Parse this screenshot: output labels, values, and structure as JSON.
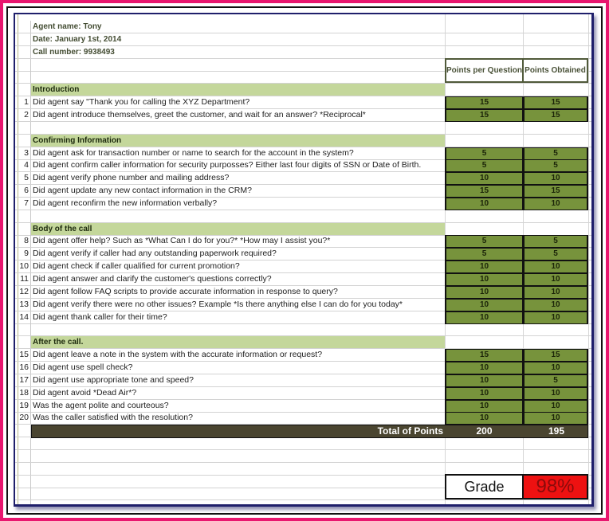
{
  "agent_info": {
    "agent_name": "Agent name: Tony",
    "date": "Date: January 1st, 2014",
    "call_number": "Call number: 9938493"
  },
  "columns": {
    "points_per_question": "Points per Question",
    "points_obtained": "Points Obtained"
  },
  "sections": [
    {
      "title": "Introduction",
      "questions": [
        {
          "num": "1",
          "text": "Did agent say \"Thank you for calling the XYZ Department?",
          "ppq": "15",
          "po": "15"
        },
        {
          "num": "2",
          "text": "Did agent introduce themselves, greet the customer, and wait for an answer? *Reciprocal*",
          "ppq": "15",
          "po": "15"
        }
      ]
    },
    {
      "title": "Confirming Information",
      "questions": [
        {
          "num": "3",
          "text": "Did agent ask for transaction number or name to search for the account in the system?",
          "ppq": "5",
          "po": "5"
        },
        {
          "num": "4",
          "text": "Did agent confirm caller information for security purposses? Either last four digits of SSN or Date of Birth.",
          "ppq": "5",
          "po": "5"
        },
        {
          "num": "5",
          "text": "Did agent verify phone number and mailing address?",
          "ppq": "10",
          "po": "10"
        },
        {
          "num": "6",
          "text": "Did agent update any new contact information in the CRM?",
          "ppq": "15",
          "po": "15"
        },
        {
          "num": "7",
          "text": "Did agent reconfirm the new information verbally?",
          "ppq": "10",
          "po": "10"
        }
      ]
    },
    {
      "title": "Body of the call",
      "questions": [
        {
          "num": "8",
          "text": "Did agent offer help? Such as *What Can I do for you?* *How may I assist you?*",
          "ppq": "5",
          "po": "5"
        },
        {
          "num": "9",
          "text": "Did agent verify if caller had any outstanding paperwork required?",
          "ppq": "5",
          "po": "5"
        },
        {
          "num": "10",
          "text": "Did agent check if caller qualified for current promotion?",
          "ppq": "10",
          "po": "10"
        },
        {
          "num": "11",
          "text": "Did agent answer and clarify the customer's questions correctly?",
          "ppq": "10",
          "po": "10"
        },
        {
          "num": "12",
          "text": "Did agent follow FAQ scripts to provide accurate information in response to query?",
          "ppq": "10",
          "po": "10"
        },
        {
          "num": "13",
          "text": "Did agent verify there were no other issues? Example *Is there anything else I can do for you today*",
          "ppq": "10",
          "po": "10"
        },
        {
          "num": "14",
          "text": "Did agent thank caller for their time?",
          "ppq": "10",
          "po": "10"
        }
      ]
    },
    {
      "title": "After the call.",
      "questions": [
        {
          "num": "15",
          "text": "Did agent leave a note in the system with the accurate information or request?",
          "ppq": "15",
          "po": "15"
        },
        {
          "num": "16",
          "text": "Did agent use spell check?",
          "ppq": "10",
          "po": "10"
        },
        {
          "num": "17",
          "text": "Did agent use appropriate tone and speed?",
          "ppq": "10",
          "po": "5"
        },
        {
          "num": "18",
          "text": "Did agent avoid *Dead Air*?",
          "ppq": "10",
          "po": "10"
        },
        {
          "num": "19",
          "text": "Was the agent polite and courteous?",
          "ppq": "10",
          "po": "10"
        },
        {
          "num": "20",
          "text": "Was the caller satisfied with the resolution?",
          "ppq": "10",
          "po": "10"
        }
      ]
    }
  ],
  "totals": {
    "label": "Total of Points",
    "points_per_question": "200",
    "points_obtained": "195"
  },
  "grade": {
    "label": "Grade",
    "value": "98%"
  },
  "colors": {
    "section_band": "#c4d79b",
    "points_cell": "#77933c",
    "total_band": "#4a4530",
    "grade_value_bg": "#ee1111",
    "outer_frame": "#e8176f",
    "sheet_border": "#1f1f6b"
  }
}
